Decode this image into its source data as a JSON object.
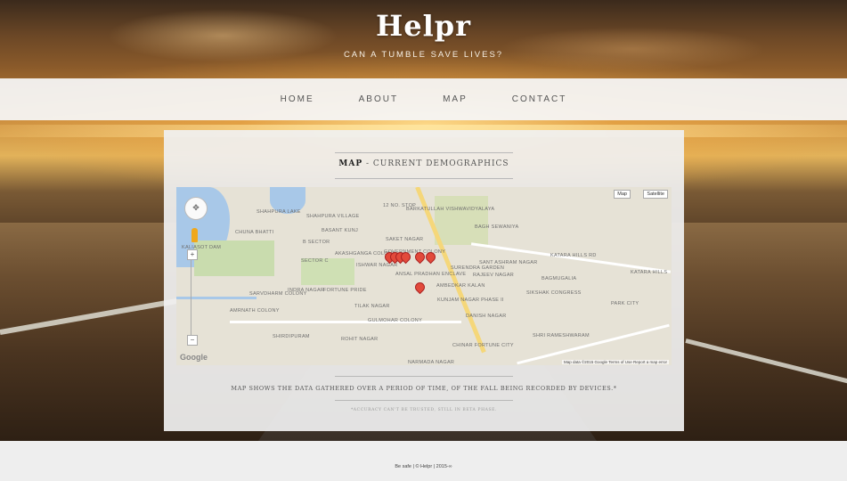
{
  "header": {
    "brand": "Helpr",
    "tagline": "Can a tumble save lives?"
  },
  "nav": {
    "items": [
      "HOME",
      "ABOUT",
      "MAP",
      "CONTACT"
    ]
  },
  "section": {
    "title_strong": "Map",
    "title_rest": " - Current Demographics"
  },
  "map": {
    "type_buttons": [
      "Map",
      "Satellite"
    ],
    "labels": [
      "Barkatullah Vishwavidyalaya",
      "Shahpura Lake",
      "Shahpura Village",
      "Basant Kunj",
      "Chuna Bhatti",
      "B Sector",
      "Kaliasot Dam",
      "Sector C",
      "Akashganga Colony",
      "Ishwar Nagar",
      "Sarvdharm Colony",
      "Indra Nagar",
      "Fortune Pride",
      "Amrnath Colony",
      "Tilak Nagar",
      "Gulmohar Colony",
      "Shirdipuram",
      "Rohit Nagar",
      "Kunjam Nagar Phase II",
      "Danish Nagar",
      "Surendra Garden",
      "Sant Ashram Nagar",
      "Rajeev Nagar",
      "Ambedkar Kalan",
      "Sikshak Congress",
      "Bagh Sewaniya",
      "Katara Hills",
      "Katara Hills Rd",
      "Bagmugalia",
      "Park City",
      "Shri Rameshwaram",
      "Chinar Fortune City",
      "Narmada Nagar",
      "12 No. Stop",
      "Saket Nagar",
      "Government Colony",
      "Ansal Pradhan Enclave"
    ],
    "google_logo": "Google",
    "attribution": "Map data ©2015 Google   Terms of Use   Report a map error",
    "markers_count": 7
  },
  "caption": "Map shows the data gathered over a period of time, of the fall being recorded by devices.*",
  "note": "*Accuracy can't be trusted, still in beta phase.",
  "footer": {
    "text": "Be safe | © Helpr | 2015-∞"
  }
}
